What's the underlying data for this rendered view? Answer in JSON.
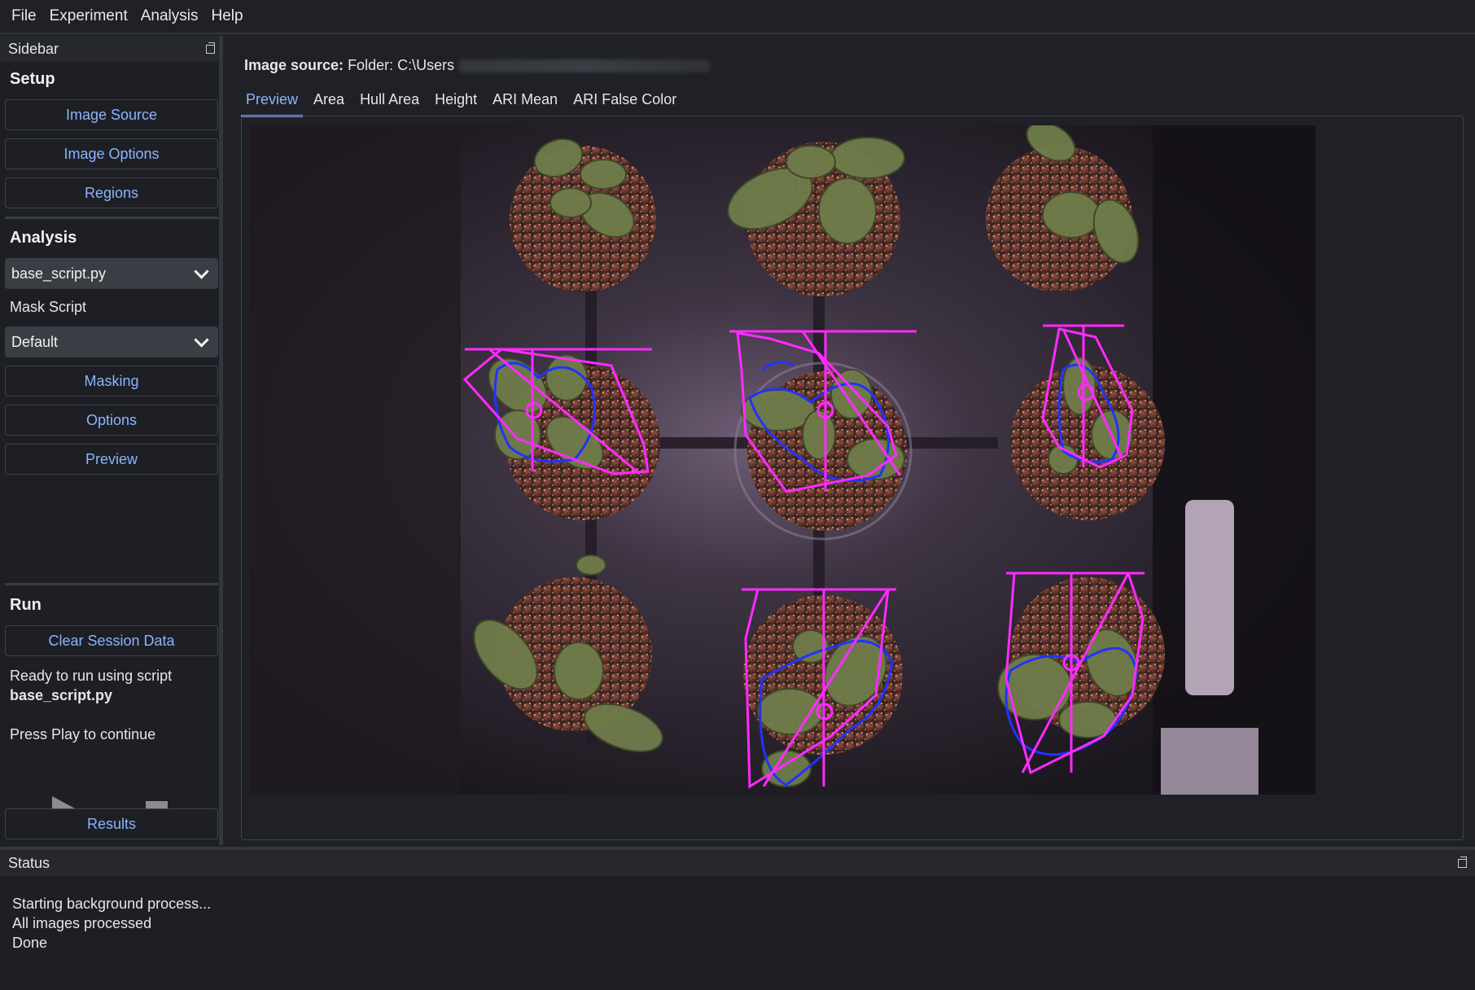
{
  "menu": [
    "File",
    "Experiment",
    "Analysis",
    "Help"
  ],
  "sidebar": {
    "title": "Sidebar",
    "setup": {
      "heading": "Setup",
      "buttons": [
        "Image Source",
        "Image Options",
        "Regions"
      ]
    },
    "analysis": {
      "heading": "Analysis",
      "script_select": "base_script.py",
      "mask_label": "Mask Script",
      "mask_select": "Default",
      "buttons": [
        "Masking",
        "Options",
        "Preview"
      ]
    },
    "run": {
      "heading": "Run",
      "clear_button": "Clear Session Data",
      "ready_text": "Ready to run using script",
      "script_name": "base_script.py",
      "prompt": "Press Play to continue",
      "results_button": "Results"
    }
  },
  "main": {
    "image_source_label": "Image source:",
    "image_source_value": "Folder: C:\\Users",
    "tabs": [
      "Preview",
      "Area",
      "Hull Area",
      "Height",
      "ARI Mean",
      "ARI False Color"
    ],
    "active_tab": "Preview"
  },
  "status": {
    "title": "Status",
    "lines": [
      "Starting background process...",
      "All images processed",
      "Done"
    ]
  },
  "colors": {
    "accent": "#8ab4ff",
    "hull": "#ff2bff",
    "contour": "#2233ff"
  },
  "icons": [
    "float-dock-icon",
    "chevron-down-icon",
    "play-icon",
    "stop-icon"
  ]
}
